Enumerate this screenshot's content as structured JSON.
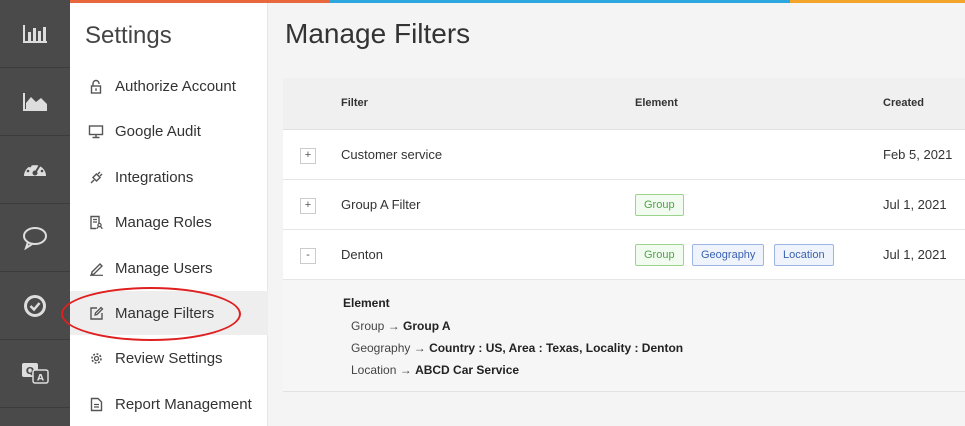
{
  "stripe_colors": [
    "#e8673c",
    "#2ba6de",
    "#f2a52a"
  ],
  "rail": {
    "items": [
      {
        "icon": "bar-chart-icon"
      },
      {
        "icon": "area-chart-icon"
      },
      {
        "icon": "dashboard-gauge-icon"
      },
      {
        "icon": "chat-bubble-icon"
      },
      {
        "icon": "check-circle-icon"
      },
      {
        "icon": "qa-icon"
      }
    ]
  },
  "sidebar": {
    "title": "Settings",
    "items": [
      {
        "label": "Authorize Account",
        "icon": "lock-icon"
      },
      {
        "label": "Google Audit",
        "icon": "monitor-icon"
      },
      {
        "label": "Integrations",
        "icon": "plug-icon"
      },
      {
        "label": "Manage Roles",
        "icon": "document-user-icon"
      },
      {
        "label": "Manage Users",
        "icon": "pencil-icon"
      },
      {
        "label": "Manage Filters",
        "icon": "edit-square-icon",
        "active": true
      },
      {
        "label": "Review Settings",
        "icon": "gear-icon"
      },
      {
        "label": "Report Management",
        "icon": "report-icon"
      }
    ]
  },
  "main": {
    "title": "Manage Filters",
    "table": {
      "columns": [
        "Filter",
        "Element",
        "Created"
      ],
      "rows": [
        {
          "toggle": "+",
          "filter": "Customer service",
          "tags": [],
          "created": "Feb 5, 2021"
        },
        {
          "toggle": "+",
          "filter": "Group A Filter",
          "tags": [
            "Group"
          ],
          "created": "Jul 1, 2021"
        },
        {
          "toggle": "-",
          "filter": "Denton",
          "tags": [
            "Group",
            "Geography",
            "Location"
          ],
          "created": "Jul 1, 2021"
        }
      ],
      "detail": {
        "title": "Element",
        "lines": [
          {
            "key": "Group",
            "arrow": "→",
            "value": "Group A"
          },
          {
            "key": "Geography",
            "arrow": "→",
            "value": "Country : US, Area : Texas, Locality : Denton"
          },
          {
            "key": "Location",
            "arrow": "→",
            "value": "ABCD Car Service"
          }
        ]
      }
    }
  },
  "colors": {
    "tag_green": "#52a24a",
    "tag_blue": "#3a62b0",
    "highlight": "#e02020"
  }
}
